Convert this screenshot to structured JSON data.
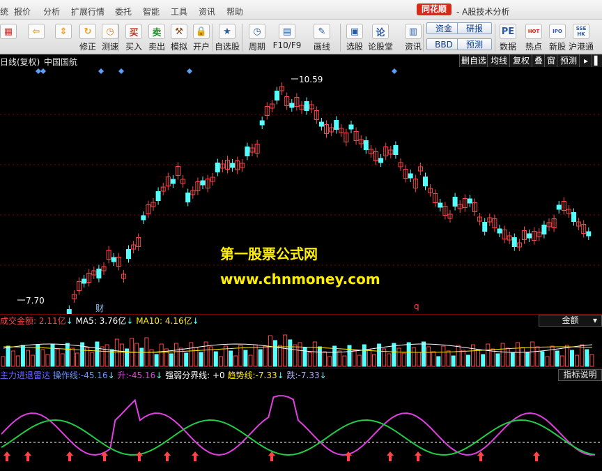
{
  "menu": [
    "统",
    "报价",
    "分析",
    "扩展行情",
    "委托",
    "智能",
    "工具",
    "资讯",
    "帮助"
  ],
  "brand": "同花顺",
  "window_title": "- A股技术分析",
  "toolbar": [
    {
      "label": "",
      "icon": "grid-icon",
      "color": "#c0392b"
    },
    {
      "label": "",
      "icon": "back-arrow-icon",
      "color": "#f0a020"
    },
    {
      "label": "",
      "icon": "up-down-arrows-icon",
      "color": "#f0a020"
    },
    {
      "label": "修正",
      "icon": "refresh-icon",
      "color": "#f0a020"
    },
    {
      "label": "测速",
      "icon": "clock-icon",
      "color": "#e08a20"
    },
    {
      "label": "买入",
      "icon": "buy-icon",
      "glyph": "买",
      "color": "#d62a1b"
    },
    {
      "label": "卖出",
      "icon": "sell-icon",
      "glyph": "卖",
      "color": "#1a8a2a"
    },
    {
      "label": "模拟",
      "icon": "hammer-icon",
      "color": "#8a4a1a"
    },
    {
      "label": "开户",
      "icon": "lock-icon",
      "color": "#a07020"
    },
    {
      "label": "自选股",
      "icon": "star-icon",
      "color": "#2a5aa0"
    },
    {
      "label": "周期",
      "icon": "period-clock-icon",
      "color": "#2a5aa0"
    },
    {
      "label": "F10/F9",
      "icon": "f10-icon",
      "color": "#2a5aa0"
    },
    {
      "label": "画线",
      "icon": "pen-icon",
      "color": "#2a5aa0"
    },
    {
      "label": "选股",
      "icon": "screen-icon",
      "color": "#2a5aa0"
    },
    {
      "label": "论股堂",
      "icon": "forum-icon",
      "glyph": "论",
      "color": "#2a5aa0"
    },
    {
      "label": "资讯",
      "icon": "news-icon",
      "color": "#2a5aa0"
    },
    {
      "label": "数据",
      "icon": "pe-icon",
      "glyph": "PE",
      "color": "#2a5aa0"
    },
    {
      "label": "热点",
      "icon": "hot-icon",
      "glyph": "HOT",
      "color": "#d62a1b"
    },
    {
      "label": "新股",
      "icon": "ipo-icon",
      "glyph": "IPO",
      "color": "#2a5aa0"
    },
    {
      "label": "沪港通",
      "icon": "sse-hk-icon",
      "glyph": "SSE HK",
      "color": "#2a5aa0"
    }
  ],
  "chips": {
    "funds": "资金",
    "bbd": "BBD",
    "research": "研报",
    "forecast": "预测"
  },
  "info": {
    "period": "日线(复权)",
    "stock_name": "中国国航"
  },
  "right_buttons": [
    "删自选",
    "均线",
    "复权",
    "叠",
    "窗",
    "预测"
  ],
  "price_high_label": "10.59",
  "price_low_label": "7.70",
  "markers": {
    "fin": "财",
    "q": "q"
  },
  "watermark": {
    "line1": "第一股票公式网",
    "line2": "www.chnmoney.com"
  },
  "volume_panel": {
    "label": "成交金额:",
    "value": "2.11亿",
    "ma5_label": "MA5:",
    "ma5_value": "3.76亿",
    "ma10_label": "MA10:",
    "ma10_value": "4.16亿",
    "dropdown": "金额"
  },
  "indicator_panel": {
    "name": "主力进退雷达",
    "op_label": "操作线:",
    "op_value": "-45.16",
    "rise_label": "升:",
    "rise_value": "-45.16",
    "split_label": "强弱分界线:",
    "split_value": "+0",
    "trend_label": "趋势线:",
    "trend_value": "-7.33",
    "fall_label": "跌:",
    "fall_value": "-7.33",
    "button": "指标说明"
  },
  "colors": {
    "up": "#ff4545",
    "down": "#54ffff",
    "accent_yellow": "#ffee00",
    "white": "#ffffff"
  }
}
